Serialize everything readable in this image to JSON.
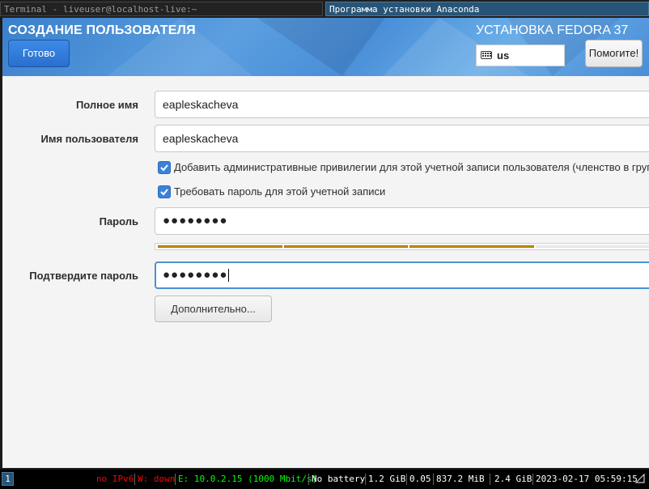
{
  "window_tabs": {
    "terminal": "Terminal - liveuser@localhost-live:~",
    "anaconda": "Программа установки Anaconda"
  },
  "header": {
    "page_title": "СОЗДАНИЕ ПОЛЬЗОВАТЕЛЯ",
    "done_label": "Готово",
    "product_title": "УСТАНОВКА FEDORA 37",
    "keyboard_layout": "us",
    "help_label": "Помогите!"
  },
  "form": {
    "fullname_label": "Полное имя",
    "fullname_value": "eapleskacheva",
    "username_label": "Имя пользователя",
    "username_value": "eapleskacheva",
    "admin_checkbox_label": "Добавить административные привилегии для этой учетной записи пользователя (членство в группе wheel)",
    "admin_checked": true,
    "require_password_label": "Требовать пароль для этой учетной записи",
    "require_password_checked": true,
    "password_label": "Пароль",
    "password_value": "●●●●●●●●",
    "strength_level": 0.75,
    "confirm_label": "Подтвердите пароль",
    "confirm_value": "●●●●●●●●",
    "advanced_label": "Дополнительно..."
  },
  "statusbar": {
    "workspace": "1",
    "ipv6": "no IPv6",
    "wireless": "W: down",
    "ethernet": "E: 10.0.2.15 (1000 Mbit/s)",
    "battery": "No battery",
    "disk": "1.2 GiB",
    "load": "0.05",
    "memory": "837.2 MiB",
    "free": "2.4 GiB",
    "datetime": "2023-02-17 05:59:15",
    "colors": {
      "bad": "#ff0000",
      "good": "#00ff00",
      "normal": "#ffffff"
    }
  }
}
